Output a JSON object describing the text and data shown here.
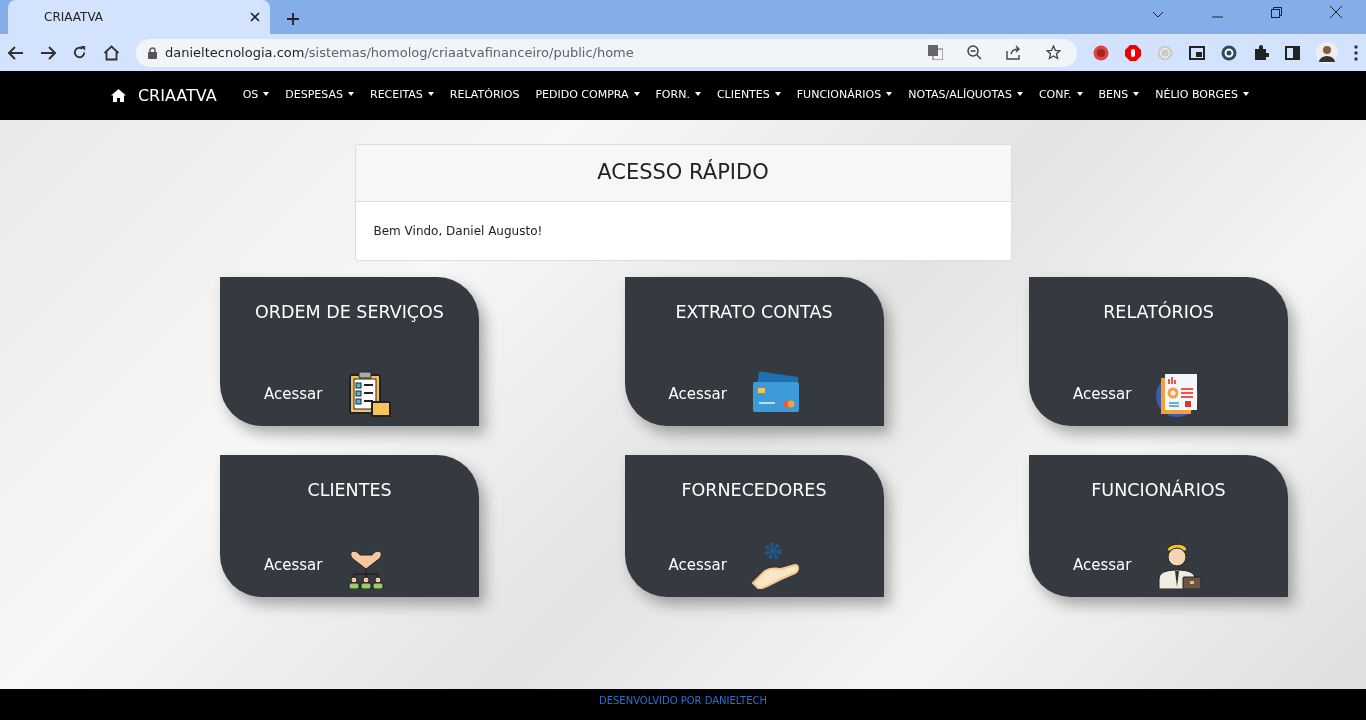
{
  "browser": {
    "tab_title": "CRIAATVA",
    "url_host": "danieltecnologia.com",
    "url_path": "/sistemas/homolog/criaatvafinanceiro/public/home"
  },
  "navbar": {
    "brand": "CRIAATVA",
    "items": [
      {
        "label": "OS",
        "dropdown": true
      },
      {
        "label": "DESPESAS",
        "dropdown": true
      },
      {
        "label": "RECEITAS",
        "dropdown": true
      },
      {
        "label": "RELATÓRIOS",
        "dropdown": false
      },
      {
        "label": "PEDIDO COMPRA",
        "dropdown": true
      },
      {
        "label": "FORN.",
        "dropdown": true
      },
      {
        "label": "CLIENTES",
        "dropdown": true
      },
      {
        "label": "FUNCIONÁRIOS",
        "dropdown": true
      },
      {
        "label": "NOTAS/ALÍQUOTAS",
        "dropdown": true
      },
      {
        "label": "CONF.",
        "dropdown": true
      },
      {
        "label": "BENS",
        "dropdown": true
      },
      {
        "label": "NÉLIO BORGES",
        "dropdown": true
      }
    ]
  },
  "quick_access": {
    "title": "ACESSO RÁPIDO",
    "welcome": "Bem Vindo, Daniel Augusto!"
  },
  "tiles": [
    {
      "title": "ORDEM DE SERVIÇOS",
      "link": "Acessar"
    },
    {
      "title": "EXTRATO CONTAS",
      "link": "Acessar"
    },
    {
      "title": "RELATÓRIOS",
      "link": "Acessar"
    },
    {
      "title": "CLIENTES",
      "link": "Acessar"
    },
    {
      "title": "FORNECEDORES",
      "link": "Acessar"
    },
    {
      "title": "FUNCIONÁRIOS",
      "link": "Acessar"
    }
  ],
  "footer": "DESENVOLVIDO POR DANIELTECH"
}
